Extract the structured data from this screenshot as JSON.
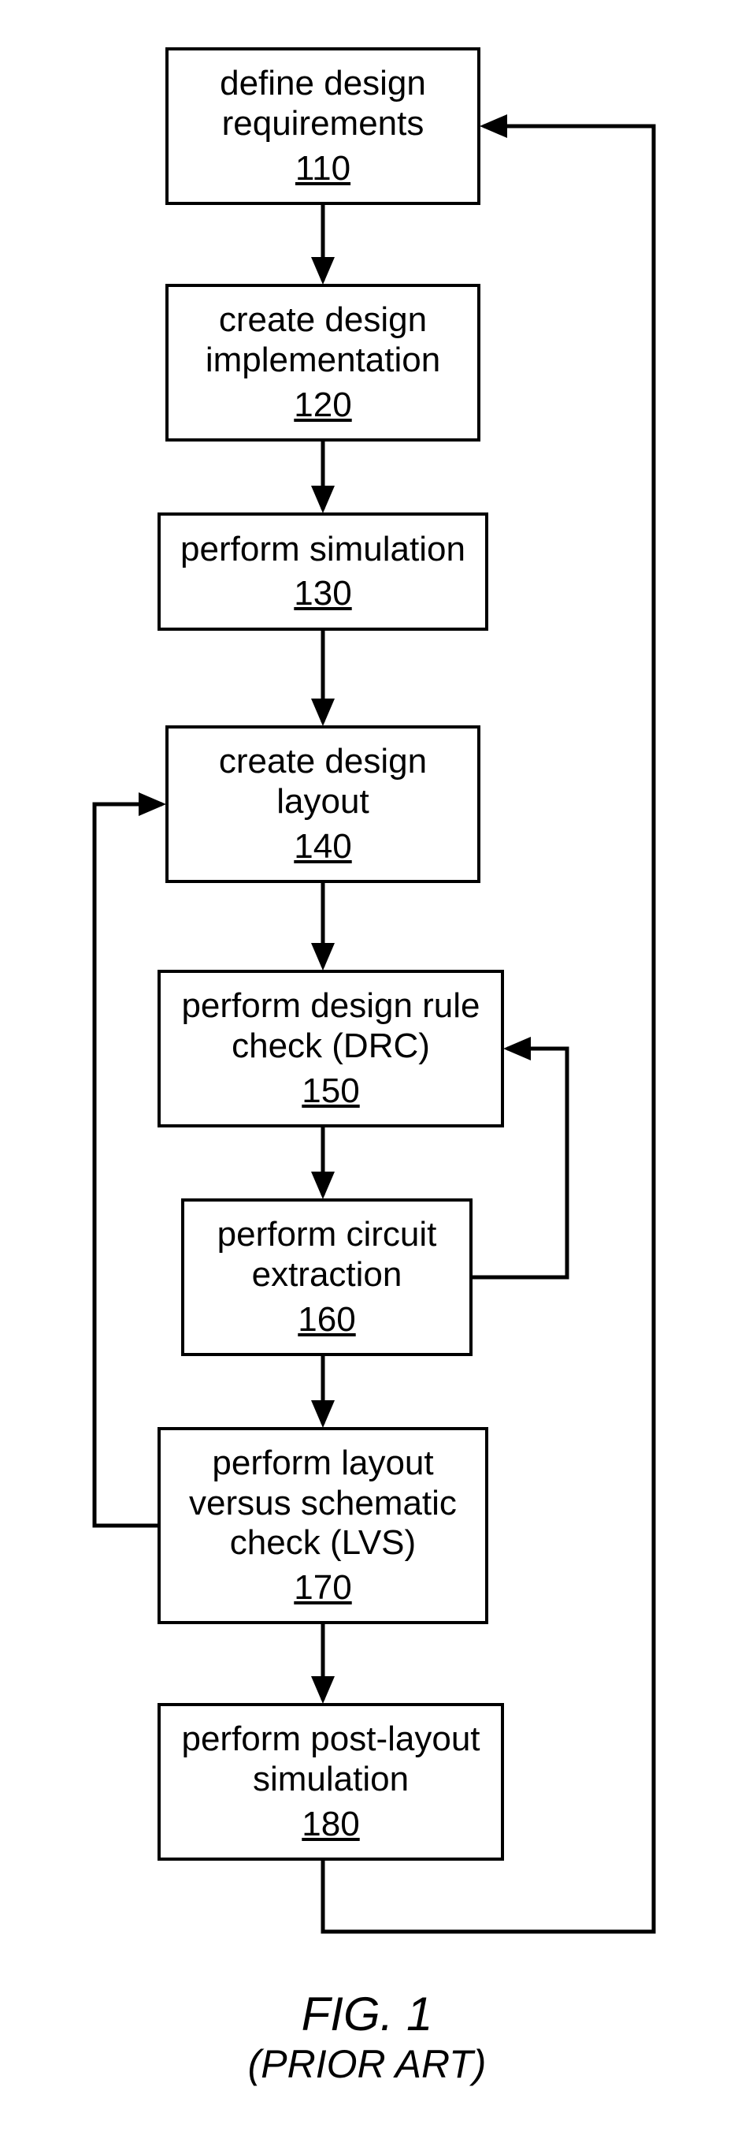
{
  "boxes": {
    "b110": {
      "label": "define design\nrequirements",
      "num": "110"
    },
    "b120": {
      "label": "create design\nimplementation",
      "num": "120"
    },
    "b130": {
      "label": "perform simulation",
      "num": "130"
    },
    "b140": {
      "label": "create design\nlayout",
      "num": "140"
    },
    "b150": {
      "label": "perform design rule\ncheck (DRC)",
      "num": "150"
    },
    "b160": {
      "label": "perform circuit\nextraction",
      "num": "160"
    },
    "b170": {
      "label": "perform layout\nversus schematic\ncheck (LVS)",
      "num": "170"
    },
    "b180": {
      "label": "perform post-layout\nsimulation",
      "num": "180"
    }
  },
  "caption": {
    "fig": "FIG. 1",
    "sub": "(PRIOR ART)"
  },
  "chart_data": {
    "type": "flowchart",
    "nodes": [
      {
        "id": "110",
        "text": "define design requirements"
      },
      {
        "id": "120",
        "text": "create design implementation"
      },
      {
        "id": "130",
        "text": "perform simulation"
      },
      {
        "id": "140",
        "text": "create design layout"
      },
      {
        "id": "150",
        "text": "perform design rule check (DRC)"
      },
      {
        "id": "160",
        "text": "perform circuit extraction"
      },
      {
        "id": "170",
        "text": "perform layout versus schematic check (LVS)"
      },
      {
        "id": "180",
        "text": "perform post-layout simulation"
      }
    ],
    "edges": [
      {
        "from": "110",
        "to": "120"
      },
      {
        "from": "120",
        "to": "130"
      },
      {
        "from": "130",
        "to": "140"
      },
      {
        "from": "140",
        "to": "150"
      },
      {
        "from": "150",
        "to": "160"
      },
      {
        "from": "160",
        "to": "170"
      },
      {
        "from": "170",
        "to": "180"
      },
      {
        "from": "160",
        "to": "150",
        "feedback": true
      },
      {
        "from": "170",
        "to": "140",
        "feedback": true
      },
      {
        "from": "180",
        "to": "110",
        "feedback": true
      }
    ],
    "caption": "FIG. 1 (PRIOR ART)"
  }
}
